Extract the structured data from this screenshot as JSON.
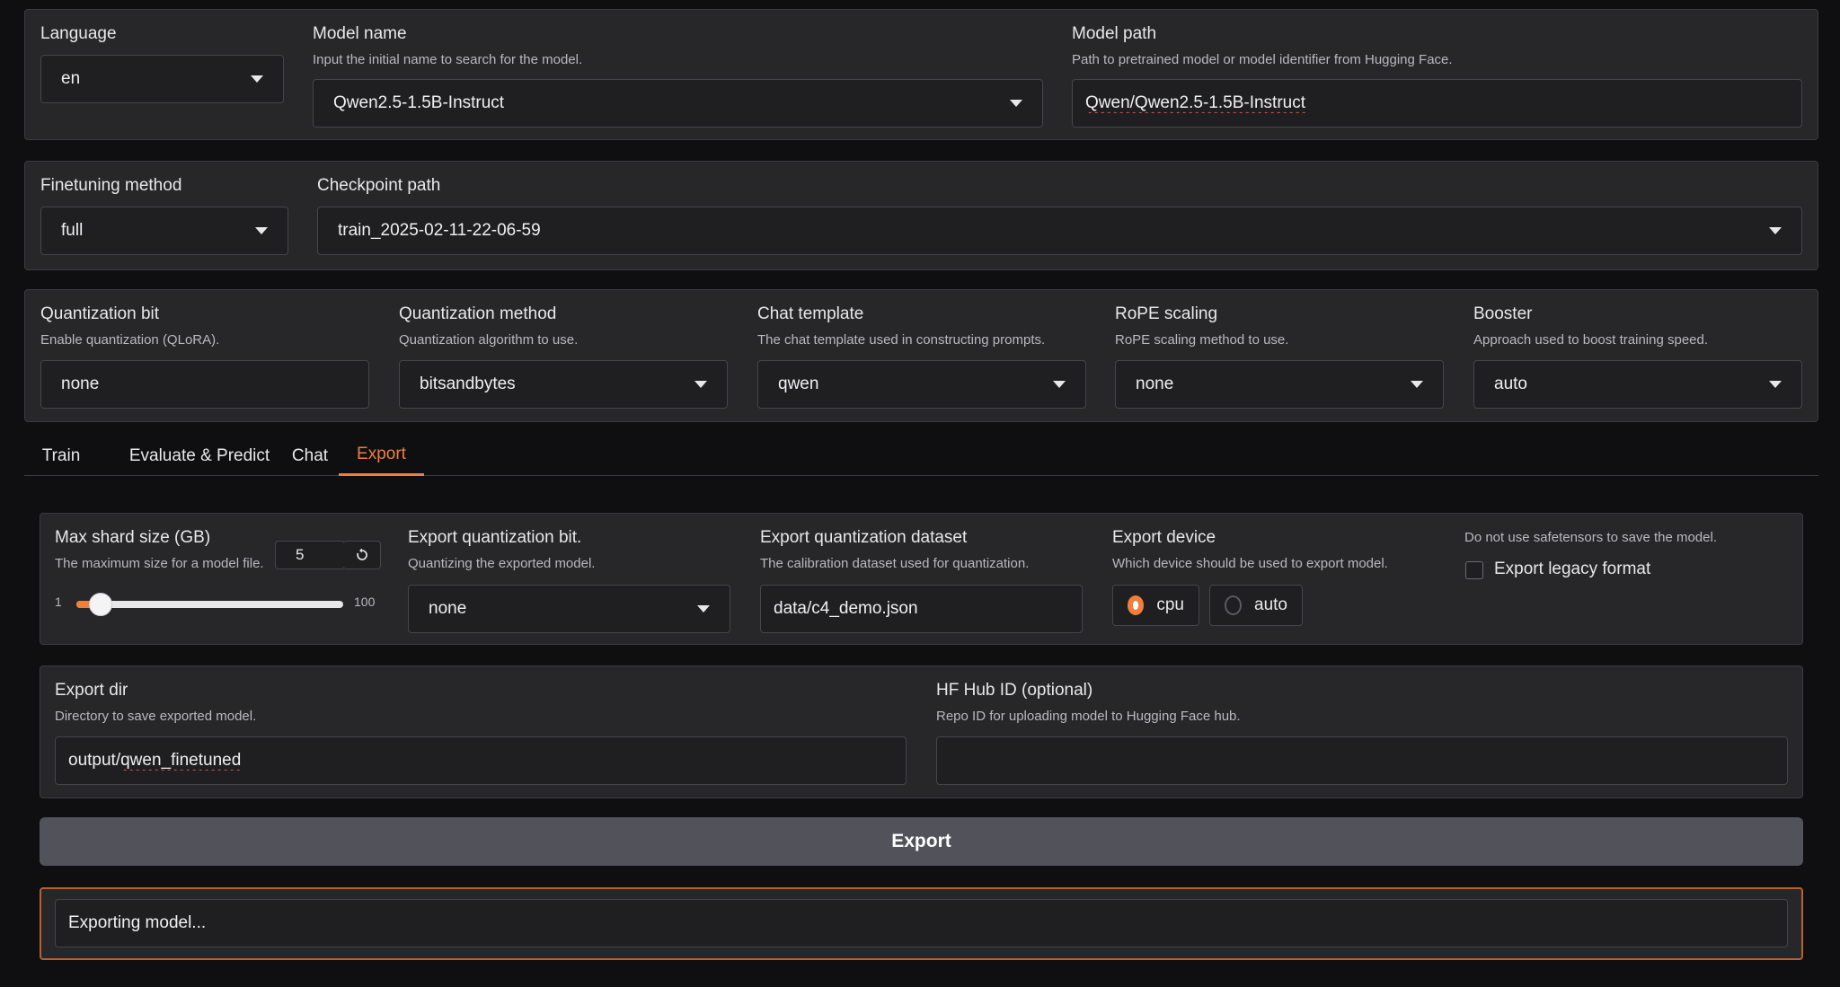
{
  "top": {
    "language": {
      "label": "Language",
      "value": "en"
    },
    "model_name": {
      "label": "Model name",
      "info": "Input the initial name to search for the model.",
      "value": "Qwen2.5-1.5B-Instruct"
    },
    "model_path": {
      "label": "Model path",
      "info": "Path to pretrained model or model identifier from Hugging Face.",
      "value": "Qwen/Qwen2.5-1.5B-Instruct"
    }
  },
  "finetune": {
    "method": {
      "label": "Finetuning method",
      "value": "full"
    },
    "checkpoint": {
      "label": "Checkpoint path",
      "value": "train_2025-02-11-22-06-59"
    }
  },
  "advanced": {
    "quant_bit": {
      "label": "Quantization bit",
      "info": "Enable quantization (QLoRA).",
      "value": "none"
    },
    "quant_method": {
      "label": "Quantization method",
      "info": "Quantization algorithm to use.",
      "value": "bitsandbytes"
    },
    "template": {
      "label": "Chat template",
      "info": "The chat template used in constructing prompts.",
      "value": "qwen"
    },
    "rope": {
      "label": "RoPE scaling",
      "info": "RoPE scaling method to use.",
      "value": "none"
    },
    "booster": {
      "label": "Booster",
      "info": "Approach used to boost training speed.",
      "value": "auto"
    }
  },
  "tabs": [
    {
      "label": "Train"
    },
    {
      "label": "Evaluate & Predict"
    },
    {
      "label": "Chat"
    },
    {
      "label": "Export"
    }
  ],
  "export": {
    "shard": {
      "label": "Max shard size (GB)",
      "info": "The maximum size for a model file.",
      "value": "5",
      "min": "1",
      "max": "100",
      "reset_icon": "reset-icon",
      "level": 5
    },
    "quant_bit": {
      "label": "Export quantization bit.",
      "info": "Quantizing the exported model.",
      "value": "none"
    },
    "quant_dataset": {
      "label": "Export quantization dataset",
      "info": "The calibration dataset used for quantization.",
      "value": "data/c4_demo.json"
    },
    "device": {
      "label": "Export device",
      "info": "Which device should be used to export model.",
      "options": [
        "cpu",
        "auto"
      ],
      "selected": "cpu"
    },
    "legacy": {
      "info": "Do not use safetensors to save the model.",
      "label": "Export legacy format",
      "checked": false
    },
    "dir": {
      "label": "Export dir",
      "info": "Directory to save exported model.",
      "value": "output/qwen_finetuned"
    },
    "hub": {
      "label": "HF Hub ID (optional)",
      "info": "Repo ID for uploading model to Hugging Face hub.",
      "value": ""
    },
    "button_label": "Export",
    "output": "Exporting model..."
  },
  "colors": {
    "accent": "#f07f3c",
    "panel": "#27272a",
    "background": "#0f0f11"
  }
}
